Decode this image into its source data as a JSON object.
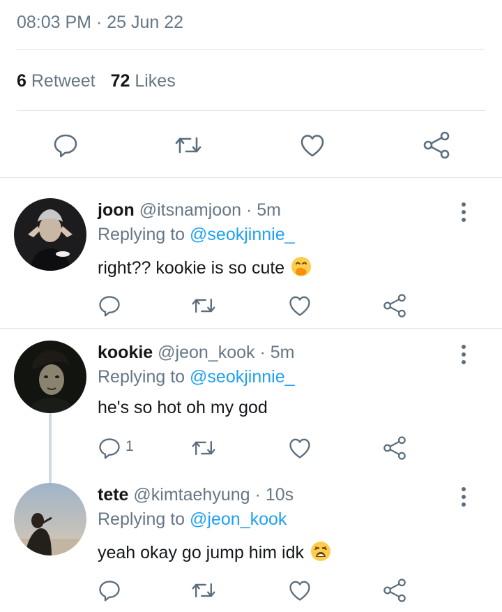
{
  "tweet": {
    "timestamp": "08:03 PM · 25 Jun 22",
    "retweet_count": "6",
    "retweet_label": "Retweet",
    "like_count": "72",
    "like_label": "Likes"
  },
  "replies": [
    {
      "name": "joon",
      "handle": "@itsnamjoon",
      "time": "5m",
      "replying_label": "Replying to",
      "replying_to": "@seokjinnie_",
      "text": "right?? kookie is so cute",
      "emoji": "hand-over-mouth-emoji",
      "reply_count": ""
    },
    {
      "name": "kookie",
      "handle": "@jeon_kook",
      "time": "5m",
      "replying_label": "Replying to",
      "replying_to": "@seokjinnie_",
      "text": "he's so hot oh my god",
      "reply_count": "1"
    },
    {
      "name": "tete",
      "handle": "@kimtaehyung",
      "time": "10s",
      "replying_label": "Replying to",
      "replying_to": "@jeon_kook",
      "text": "yeah okay go jump him idk",
      "emoji": "weary-face-emoji",
      "reply_count": ""
    }
  ],
  "colors": {
    "icon": "#5b6e7d",
    "muted_text": "#657786",
    "mention": "#1da1f2",
    "divider": "#dfe3e6"
  },
  "icons": [
    "comment-icon",
    "retweet-icon",
    "heart-icon",
    "share-icon",
    "more-icon"
  ]
}
